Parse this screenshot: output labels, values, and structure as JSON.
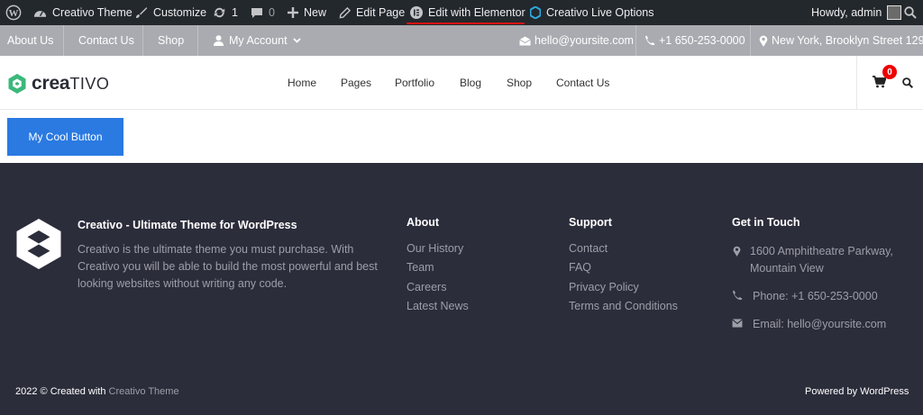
{
  "admin_bar": {
    "site_name": "Creativo Theme",
    "customize": "Customize",
    "updates_count": "1",
    "comments_count": "0",
    "new_label": "New",
    "edit_page": "Edit Page",
    "edit_elementor": "Edit with Elementor",
    "live_options": "Creativo Live Options",
    "howdy": "Howdy, admin"
  },
  "top_bar": {
    "links": [
      "About Us",
      "Contact Us",
      "Shop"
    ],
    "my_account": "My Account",
    "email": "hello@yoursite.com",
    "phone": "+1 650-253-0000",
    "location": "New York, Brooklyn Street 129"
  },
  "header": {
    "logo_bold": "crea",
    "logo_light": "TIVO",
    "nav": [
      "Home",
      "Pages",
      "Portfolio",
      "Blog",
      "Shop",
      "Contact Us"
    ],
    "cart_count": "0"
  },
  "content": {
    "button_label": "My Cool Button"
  },
  "footer": {
    "brand_title": "Creativo - Ultimate Theme for WordPress",
    "brand_desc": "Creativo is the ultimate theme you must purchase. With Creativo you will be able to build the most powerful and best looking websites without writing any code.",
    "about": {
      "title": "About",
      "links": [
        "Our History",
        "Team",
        "Careers",
        "Latest News"
      ]
    },
    "support": {
      "title": "Support",
      "links": [
        "Contact",
        "FAQ",
        "Privacy Policy",
        "Terms and Conditions"
      ]
    },
    "contact": {
      "title": "Get in Touch",
      "address_line1": "1600 Amphitheatre Parkway,",
      "address_line2": "Mountain View",
      "phone": "Phone: +1 650-253-0000",
      "email": "Email: hello@yoursite.com"
    },
    "copyright_prefix": "2022 © Created with",
    "copyright_link": "Creativo Theme",
    "powered_by": "Powered by WordPress"
  },
  "colors": {
    "admin_bar_bg": "#23282d",
    "top_bar_bg": "#a9abb1",
    "button_bg": "#2a7ae2",
    "footer_bg": "#2c2d3b",
    "logo_green": "#3bb87c",
    "cart_badge": "#e00000",
    "underline": "#dd1111"
  },
  "icons": [
    "wordpress-icon",
    "dashboard-icon",
    "brush-icon",
    "updates-icon",
    "comment-icon",
    "plus-icon",
    "pencil-icon",
    "elementor-icon",
    "creativo-hex-icon",
    "avatar",
    "search-icon",
    "user-icon",
    "chevron-down-icon",
    "envelope-icon",
    "phone-icon",
    "map-marker-icon",
    "cart-icon"
  ]
}
